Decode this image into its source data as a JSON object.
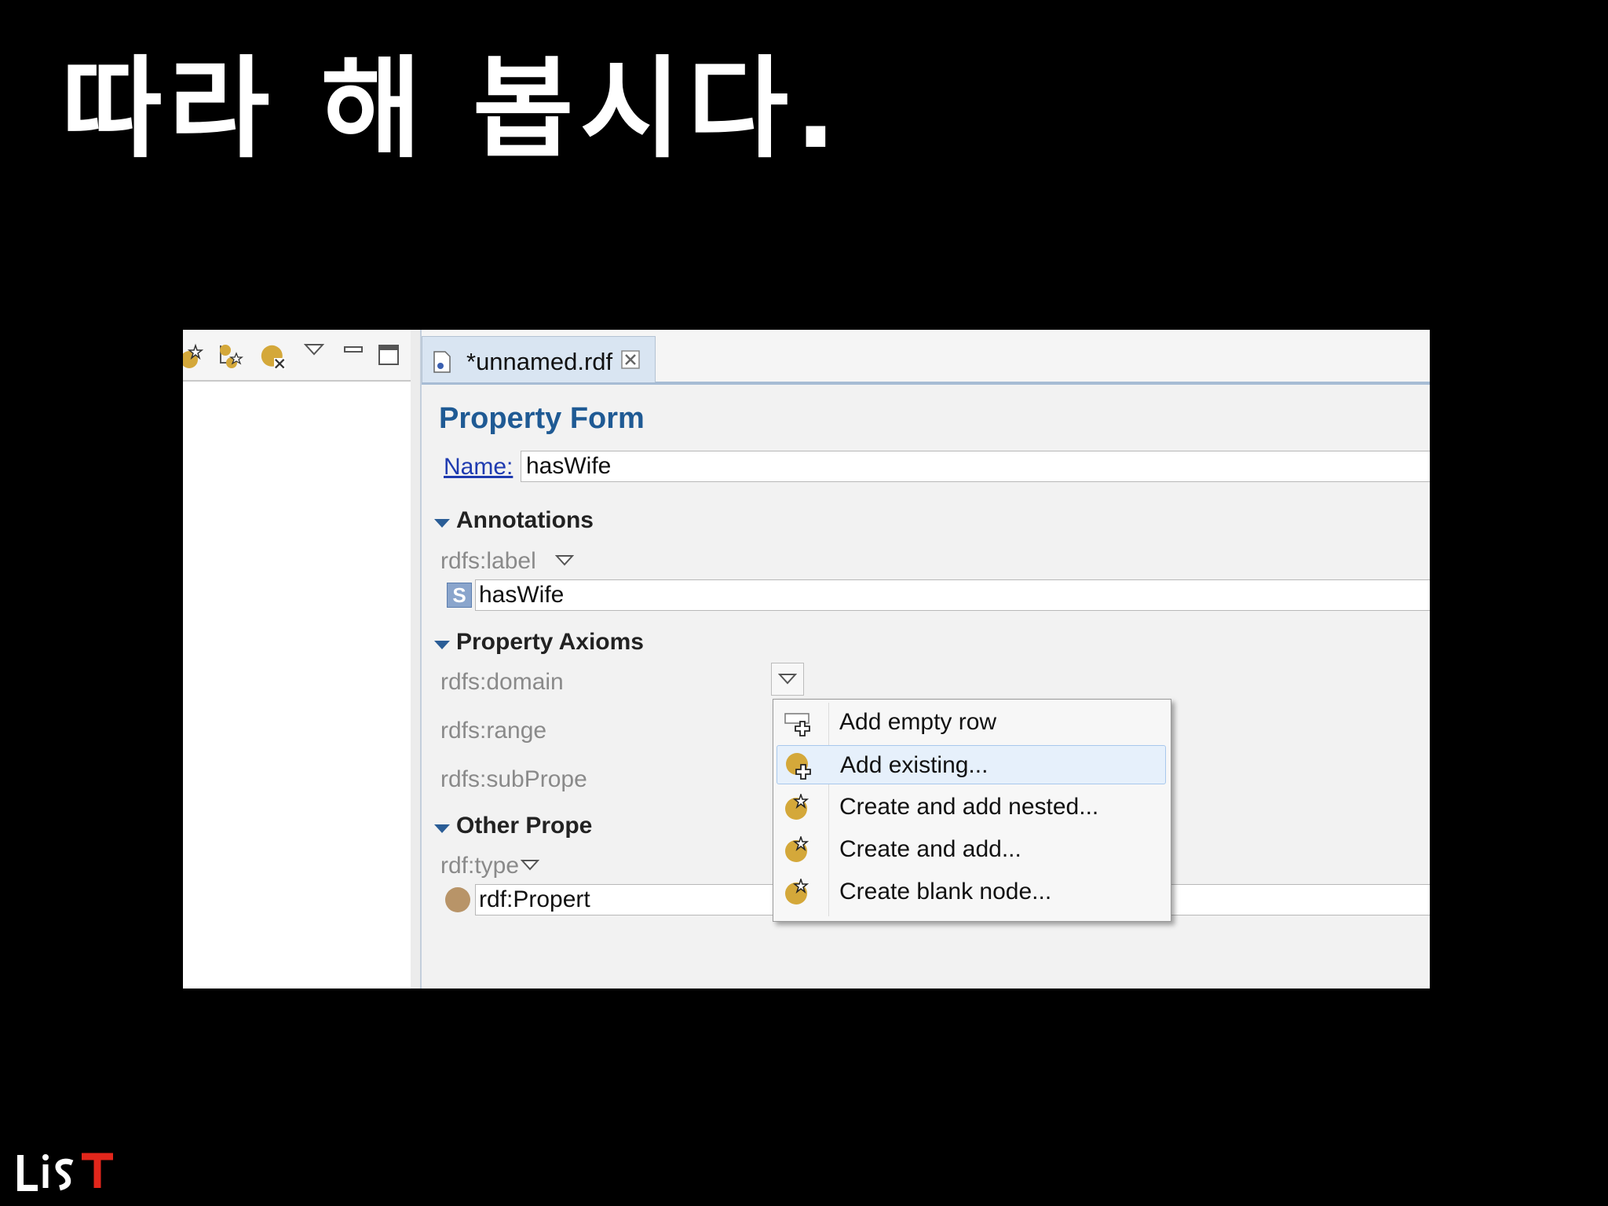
{
  "slide": {
    "title": "따라 해 봅시다."
  },
  "editor": {
    "tab_label": "*unnamed.rdf",
    "form_title": "Property Form",
    "name_label": "Name:",
    "name_value": "hasWife"
  },
  "annotations": {
    "section_title": "Annotations",
    "label_prop": "rdfs:label",
    "label_value": "hasWife",
    "string_badge": "S"
  },
  "axioms": {
    "section_title": "Property Axioms",
    "domain": "rdfs:domain",
    "range": "rdfs:range",
    "subproperty": "rdfs:subPrope"
  },
  "other": {
    "section_title": "Other Prope",
    "type_prop": "rdf:type",
    "type_value": "rdf:Propert"
  },
  "menu": {
    "items": [
      {
        "label": "Add empty row",
        "icon": "add-row-icon"
      },
      {
        "label": "Add existing...",
        "icon": "add-existing-icon",
        "selected": true
      },
      {
        "label": "Create and add nested...",
        "icon": "create-nested-icon"
      },
      {
        "label": "Create and add...",
        "icon": "create-add-icon"
      },
      {
        "label": "Create blank node...",
        "icon": "blank-node-icon"
      }
    ]
  },
  "colors": {
    "accent": "#1f5a94",
    "icon_gold": "#d4a83a",
    "link": "#1f3bb0"
  },
  "logo": {
    "text": "LiST"
  }
}
